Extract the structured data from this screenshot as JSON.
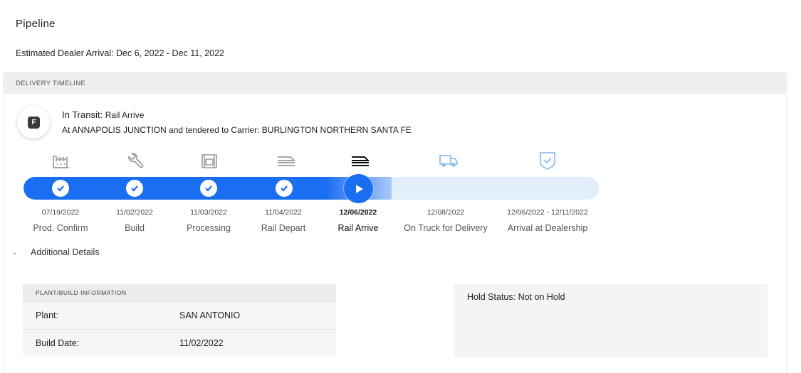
{
  "page": {
    "title": "Pipeline",
    "eta_label": "Estimated Dealer Arrival: Dec 6, 2022 - Dec 11, 2022"
  },
  "timeline": {
    "header": "DELIVERY TIMELINE",
    "badge_letter": "F",
    "status_prefix": "In Transit: ",
    "status_value": "Rail Arrive",
    "location_text": "At ANNAPOLIS JUNCTION and tendered to Carrier: BURLINGTON NORTHERN SANTA FE",
    "progress_fraction": 0.64,
    "steps": [
      {
        "date": "07/19/2022",
        "label": "Prod. Confirm",
        "state": "complete",
        "icon": "factory-icon"
      },
      {
        "date": "11/02/2022",
        "label": "Build",
        "state": "complete",
        "icon": "wrench-icon"
      },
      {
        "date": "11/03/2022",
        "label": "Processing",
        "state": "complete",
        "icon": "processing-icon"
      },
      {
        "date": "11/04/2022",
        "label": "Rail Depart",
        "state": "complete",
        "icon": "rail-car-icon"
      },
      {
        "date": "12/06/2022",
        "label": "Rail Arrive",
        "state": "current",
        "icon": "rail-car-icon"
      },
      {
        "date": "12/08/2022",
        "label": "On Truck for Delivery",
        "state": "upcoming",
        "icon": "truck-icon"
      },
      {
        "date": "12/06/2022 - 12/11/2022",
        "label": "Arrival at Dealership",
        "state": "upcoming",
        "icon": "shield-check-icon"
      }
    ],
    "colors": {
      "accent": "#1a6ef2",
      "track": "#e2eefc",
      "icon_done": "#9a9a9a",
      "icon_upcoming": "#8fbfe8",
      "badge": "#3a3a3a"
    }
  },
  "details": {
    "toggle_label": "Additional Details",
    "plant": {
      "header": "PLANT/BUILD INFORMATION",
      "rows": [
        {
          "key": "Plant:",
          "value": "SAN ANTONIO"
        },
        {
          "key": "Build Date:",
          "value": "11/02/2022"
        }
      ]
    },
    "hold_status": "Hold Status: Not on Hold"
  }
}
